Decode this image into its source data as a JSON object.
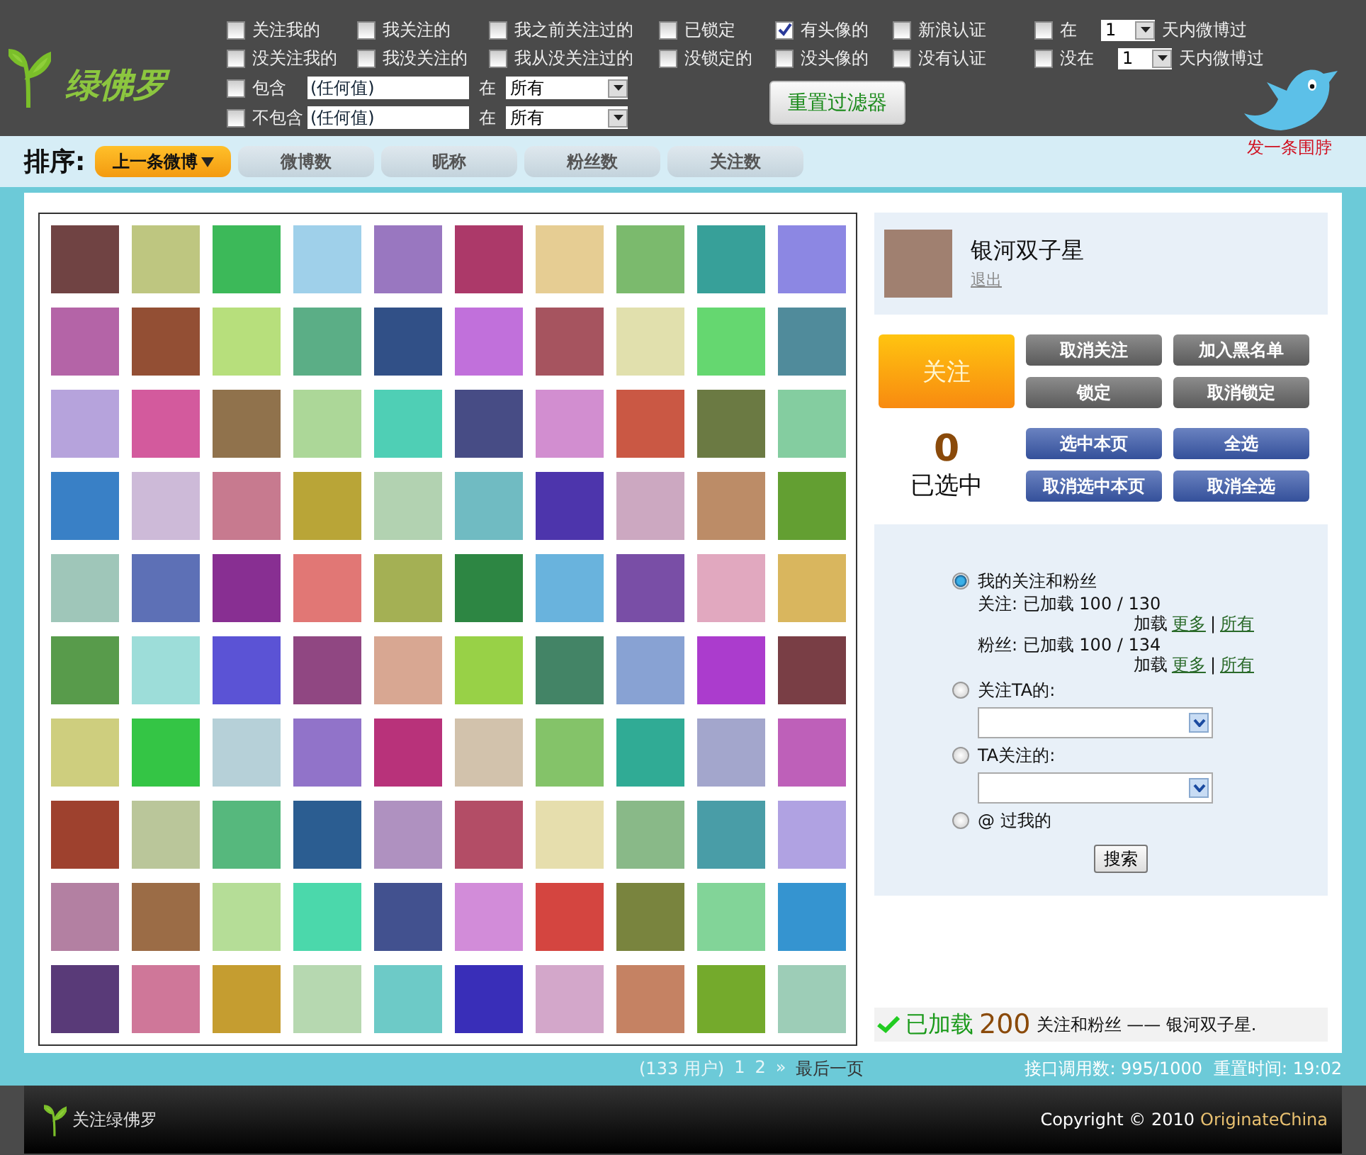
{
  "logo": {
    "text": "绿佛罗"
  },
  "filters": {
    "columns": [
      {
        "items": [
          {
            "label": "关注我的",
            "checked": false
          },
          {
            "label": "没关注我的",
            "checked": false
          }
        ]
      },
      {
        "items": [
          {
            "label": "我关注的",
            "checked": false
          },
          {
            "label": "我没关注的",
            "checked": false
          }
        ]
      },
      {
        "items": [
          {
            "label": "我之前关注过的",
            "checked": false
          },
          {
            "label": "我从没关注过的",
            "checked": false
          }
        ]
      },
      {
        "items": [
          {
            "label": "已锁定",
            "checked": false
          },
          {
            "label": "没锁定的",
            "checked": false
          }
        ]
      },
      {
        "items": [
          {
            "label": "有头像的",
            "checked": true
          },
          {
            "label": "没头像的",
            "checked": false
          }
        ]
      },
      {
        "items": [
          {
            "label": "新浪认证",
            "checked": false
          },
          {
            "label": "没有认证",
            "checked": false
          }
        ]
      },
      {
        "items": [
          {
            "label": "在",
            "checked": false,
            "days": "1",
            "suffix": "天内微博过"
          },
          {
            "label": "没在",
            "checked": false,
            "days": "1",
            "suffix": "天内微博过"
          }
        ]
      }
    ],
    "text_filters": [
      {
        "label": "包含",
        "checked": false,
        "value": "(任何值)",
        "in_label": "在",
        "scope": "所有"
      },
      {
        "label": "不包含",
        "checked": false,
        "value": "(任何值)",
        "in_label": "在",
        "scope": "所有"
      }
    ],
    "reset_button": "重置过滤器"
  },
  "tweet_link": "发一条围脖",
  "sort": {
    "label": "排序:",
    "tabs": [
      {
        "label": "上一条微博",
        "selected": true
      },
      {
        "label": "微博数",
        "selected": false
      },
      {
        "label": "昵称",
        "selected": false
      },
      {
        "label": "粉丝数",
        "selected": false
      },
      {
        "label": "关注数",
        "selected": false
      }
    ]
  },
  "user": {
    "name": "银河双子星",
    "logout": "退出"
  },
  "follow_button": "关注",
  "action_buttons": [
    {
      "label": "取消关注",
      "kind": "gray"
    },
    {
      "label": "加入黑名单",
      "kind": "gray"
    },
    {
      "label": "锁定",
      "kind": "gray"
    },
    {
      "label": "取消锁定",
      "kind": "gray"
    }
  ],
  "selection": {
    "count": "0",
    "label": "已选中",
    "buttons": [
      {
        "label": "选中本页",
        "kind": "blue"
      },
      {
        "label": "全选",
        "kind": "blue"
      },
      {
        "label": "取消选中本页",
        "kind": "blue"
      },
      {
        "label": "取消全选",
        "kind": "blue"
      }
    ]
  },
  "source": {
    "options": [
      {
        "label": "我的关注和粉丝",
        "selected": true,
        "kind": "loaded",
        "details": [
          {
            "text": "关注: 已加载 100 / 130",
            "load": "加载",
            "more": "更多",
            "sep": "|",
            "all": "所有"
          },
          {
            "text": "粉丝: 已加载 100 / 134",
            "load": "加载",
            "more": "更多",
            "sep": "|",
            "all": "所有"
          }
        ]
      },
      {
        "label": "关注TA的:",
        "selected": false,
        "kind": "dropdown"
      },
      {
        "label": "TA关注的:",
        "selected": false,
        "kind": "dropdown"
      },
      {
        "label": "@ 过我的",
        "selected": false,
        "kind": "plain"
      }
    ],
    "search_button": "搜索"
  },
  "loaded_status": {
    "prefix": "已加载",
    "count": "200",
    "suffix": "关注和粉丝 —— 银河双子星."
  },
  "pagination": {
    "users": "(133 用户)",
    "pages": [
      "1",
      "2"
    ],
    "next": "»",
    "last": "最后一页"
  },
  "api": {
    "calls": "接口调用数: 995/1000",
    "reset": "重置时间: 19:02"
  },
  "footer": {
    "brand": "关注绿佛罗",
    "copyright": "Copyright © 2010",
    "company": "OriginateChina"
  }
}
